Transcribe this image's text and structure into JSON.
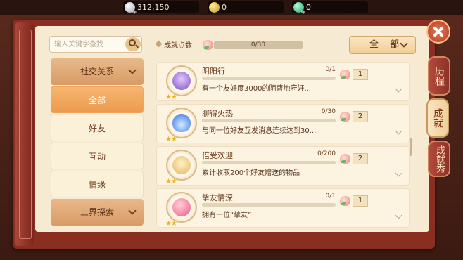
{
  "currencies": [
    {
      "icon": "silver-coin-icon",
      "value": "312,150"
    },
    {
      "icon": "gold-coin-icon",
      "value": "0"
    },
    {
      "icon": "jade-icon",
      "value": "0"
    }
  ],
  "search": {
    "placeholder": "输入关键字查找"
  },
  "menu": {
    "category_label": "社交关系",
    "items": [
      {
        "label": "全部",
        "active": true
      },
      {
        "label": "好友",
        "active": false
      },
      {
        "label": "互动",
        "active": false
      },
      {
        "label": "情缘",
        "active": false
      }
    ],
    "next_category_label": "三界探索"
  },
  "header": {
    "points_label": "成就点数",
    "points_progress": "0/30",
    "filter_label": "全 部"
  },
  "achievements": [
    {
      "icon": "ghost-lantern-icon",
      "title": "阴阳行",
      "progress": "0/1",
      "description": "有一个友好度3000的阴曹地府好...",
      "reward_count": "1",
      "stars": 2
    },
    {
      "icon": "blue-fire-icon",
      "title": "聊得火热",
      "progress": "0/30",
      "description": "与同一位好友互发消息连续达到30...",
      "reward_count": "2",
      "stars": 2
    },
    {
      "icon": "cake-icon",
      "title": "倍受欢迎",
      "progress": "0/200",
      "description": "累计收取200个好友赠送的物品",
      "reward_count": "2",
      "stars": 2
    },
    {
      "icon": "heart-icon",
      "title": "挚友情深",
      "progress": "0/1",
      "description": "拥有一位“挚友”",
      "reward_count": "1",
      "stars": 2
    }
  ],
  "tabs": [
    {
      "label": "历程",
      "active": false
    },
    {
      "label": "成就",
      "active": true
    },
    {
      "label": "成就秀",
      "active": false
    }
  ]
}
